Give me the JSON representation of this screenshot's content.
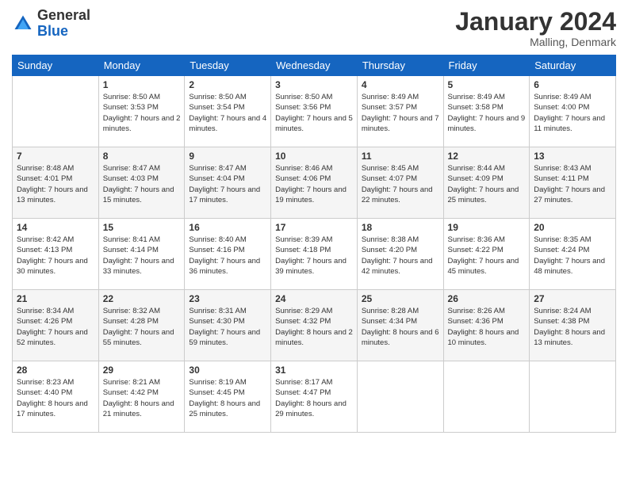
{
  "header": {
    "logo_general": "General",
    "logo_blue": "Blue",
    "month_title": "January 2024",
    "location": "Malling, Denmark"
  },
  "days_of_week": [
    "Sunday",
    "Monday",
    "Tuesday",
    "Wednesday",
    "Thursday",
    "Friday",
    "Saturday"
  ],
  "weeks": [
    [
      {
        "day": "",
        "sunrise": "",
        "sunset": "",
        "daylight": ""
      },
      {
        "day": "1",
        "sunrise": "Sunrise: 8:50 AM",
        "sunset": "Sunset: 3:53 PM",
        "daylight": "Daylight: 7 hours and 2 minutes."
      },
      {
        "day": "2",
        "sunrise": "Sunrise: 8:50 AM",
        "sunset": "Sunset: 3:54 PM",
        "daylight": "Daylight: 7 hours and 4 minutes."
      },
      {
        "day": "3",
        "sunrise": "Sunrise: 8:50 AM",
        "sunset": "Sunset: 3:56 PM",
        "daylight": "Daylight: 7 hours and 5 minutes."
      },
      {
        "day": "4",
        "sunrise": "Sunrise: 8:49 AM",
        "sunset": "Sunset: 3:57 PM",
        "daylight": "Daylight: 7 hours and 7 minutes."
      },
      {
        "day": "5",
        "sunrise": "Sunrise: 8:49 AM",
        "sunset": "Sunset: 3:58 PM",
        "daylight": "Daylight: 7 hours and 9 minutes."
      },
      {
        "day": "6",
        "sunrise": "Sunrise: 8:49 AM",
        "sunset": "Sunset: 4:00 PM",
        "daylight": "Daylight: 7 hours and 11 minutes."
      }
    ],
    [
      {
        "day": "7",
        "sunrise": "Sunrise: 8:48 AM",
        "sunset": "Sunset: 4:01 PM",
        "daylight": "Daylight: 7 hours and 13 minutes."
      },
      {
        "day": "8",
        "sunrise": "Sunrise: 8:47 AM",
        "sunset": "Sunset: 4:03 PM",
        "daylight": "Daylight: 7 hours and 15 minutes."
      },
      {
        "day": "9",
        "sunrise": "Sunrise: 8:47 AM",
        "sunset": "Sunset: 4:04 PM",
        "daylight": "Daylight: 7 hours and 17 minutes."
      },
      {
        "day": "10",
        "sunrise": "Sunrise: 8:46 AM",
        "sunset": "Sunset: 4:06 PM",
        "daylight": "Daylight: 7 hours and 19 minutes."
      },
      {
        "day": "11",
        "sunrise": "Sunrise: 8:45 AM",
        "sunset": "Sunset: 4:07 PM",
        "daylight": "Daylight: 7 hours and 22 minutes."
      },
      {
        "day": "12",
        "sunrise": "Sunrise: 8:44 AM",
        "sunset": "Sunset: 4:09 PM",
        "daylight": "Daylight: 7 hours and 25 minutes."
      },
      {
        "day": "13",
        "sunrise": "Sunrise: 8:43 AM",
        "sunset": "Sunset: 4:11 PM",
        "daylight": "Daylight: 7 hours and 27 minutes."
      }
    ],
    [
      {
        "day": "14",
        "sunrise": "Sunrise: 8:42 AM",
        "sunset": "Sunset: 4:13 PM",
        "daylight": "Daylight: 7 hours and 30 minutes."
      },
      {
        "day": "15",
        "sunrise": "Sunrise: 8:41 AM",
        "sunset": "Sunset: 4:14 PM",
        "daylight": "Daylight: 7 hours and 33 minutes."
      },
      {
        "day": "16",
        "sunrise": "Sunrise: 8:40 AM",
        "sunset": "Sunset: 4:16 PM",
        "daylight": "Daylight: 7 hours and 36 minutes."
      },
      {
        "day": "17",
        "sunrise": "Sunrise: 8:39 AM",
        "sunset": "Sunset: 4:18 PM",
        "daylight": "Daylight: 7 hours and 39 minutes."
      },
      {
        "day": "18",
        "sunrise": "Sunrise: 8:38 AM",
        "sunset": "Sunset: 4:20 PM",
        "daylight": "Daylight: 7 hours and 42 minutes."
      },
      {
        "day": "19",
        "sunrise": "Sunrise: 8:36 AM",
        "sunset": "Sunset: 4:22 PM",
        "daylight": "Daylight: 7 hours and 45 minutes."
      },
      {
        "day": "20",
        "sunrise": "Sunrise: 8:35 AM",
        "sunset": "Sunset: 4:24 PM",
        "daylight": "Daylight: 7 hours and 48 minutes."
      }
    ],
    [
      {
        "day": "21",
        "sunrise": "Sunrise: 8:34 AM",
        "sunset": "Sunset: 4:26 PM",
        "daylight": "Daylight: 7 hours and 52 minutes."
      },
      {
        "day": "22",
        "sunrise": "Sunrise: 8:32 AM",
        "sunset": "Sunset: 4:28 PM",
        "daylight": "Daylight: 7 hours and 55 minutes."
      },
      {
        "day": "23",
        "sunrise": "Sunrise: 8:31 AM",
        "sunset": "Sunset: 4:30 PM",
        "daylight": "Daylight: 7 hours and 59 minutes."
      },
      {
        "day": "24",
        "sunrise": "Sunrise: 8:29 AM",
        "sunset": "Sunset: 4:32 PM",
        "daylight": "Daylight: 8 hours and 2 minutes."
      },
      {
        "day": "25",
        "sunrise": "Sunrise: 8:28 AM",
        "sunset": "Sunset: 4:34 PM",
        "daylight": "Daylight: 8 hours and 6 minutes."
      },
      {
        "day": "26",
        "sunrise": "Sunrise: 8:26 AM",
        "sunset": "Sunset: 4:36 PM",
        "daylight": "Daylight: 8 hours and 10 minutes."
      },
      {
        "day": "27",
        "sunrise": "Sunrise: 8:24 AM",
        "sunset": "Sunset: 4:38 PM",
        "daylight": "Daylight: 8 hours and 13 minutes."
      }
    ],
    [
      {
        "day": "28",
        "sunrise": "Sunrise: 8:23 AM",
        "sunset": "Sunset: 4:40 PM",
        "daylight": "Daylight: 8 hours and 17 minutes."
      },
      {
        "day": "29",
        "sunrise": "Sunrise: 8:21 AM",
        "sunset": "Sunset: 4:42 PM",
        "daylight": "Daylight: 8 hours and 21 minutes."
      },
      {
        "day": "30",
        "sunrise": "Sunrise: 8:19 AM",
        "sunset": "Sunset: 4:45 PM",
        "daylight": "Daylight: 8 hours and 25 minutes."
      },
      {
        "day": "31",
        "sunrise": "Sunrise: 8:17 AM",
        "sunset": "Sunset: 4:47 PM",
        "daylight": "Daylight: 8 hours and 29 minutes."
      },
      {
        "day": "",
        "sunrise": "",
        "sunset": "",
        "daylight": ""
      },
      {
        "day": "",
        "sunrise": "",
        "sunset": "",
        "daylight": ""
      },
      {
        "day": "",
        "sunrise": "",
        "sunset": "",
        "daylight": ""
      }
    ]
  ]
}
